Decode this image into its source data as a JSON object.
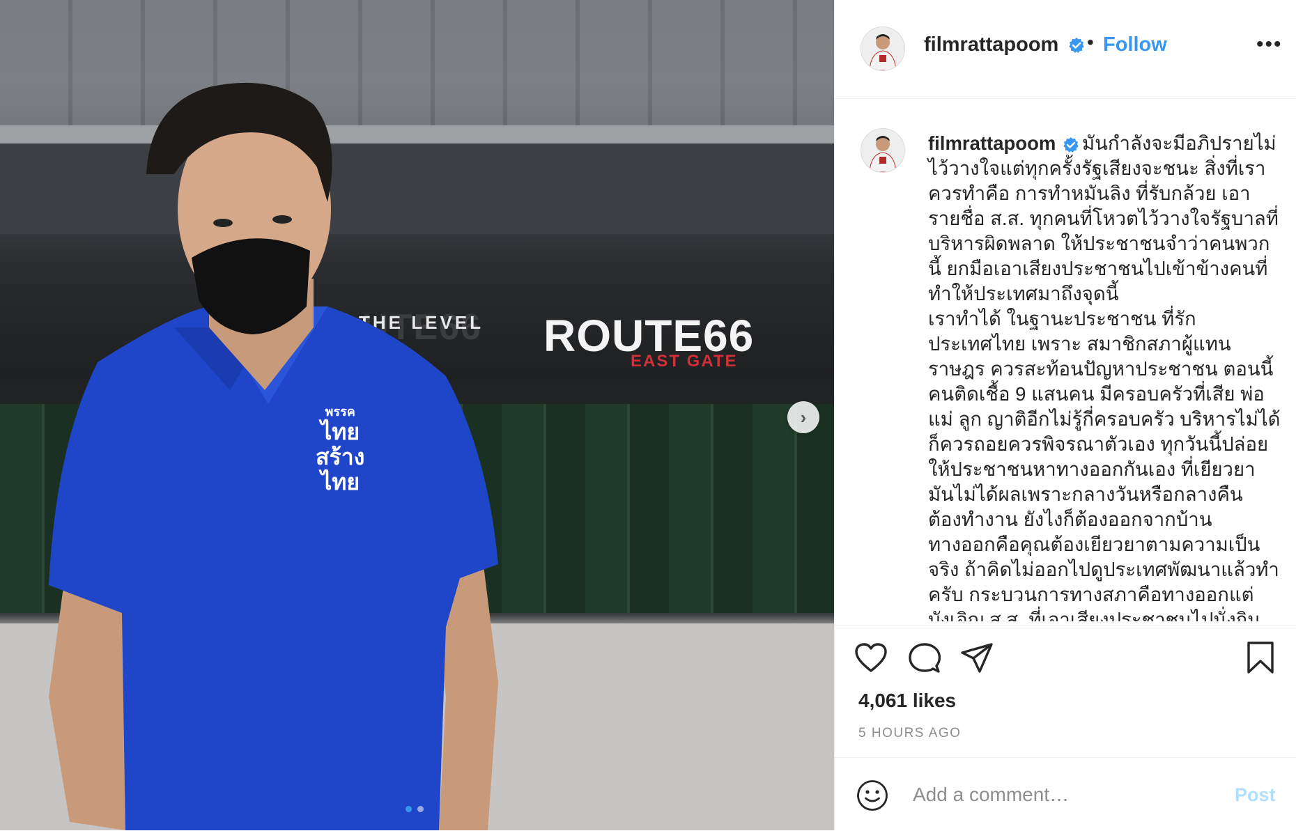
{
  "photo": {
    "signs": {
      "left_main": "UTE66",
      "left_sub": "THE LEVEL",
      "right_main": "ROUTE66",
      "right_sub": "EAST GATE"
    },
    "shirt_text": [
      "พรรค",
      "ไทย",
      "สร้าง",
      "ไทย"
    ],
    "carousel_dots": 2,
    "active_dot": 0
  },
  "header": {
    "username": "filmrattapoom",
    "separator": "•",
    "follow_label": "Follow",
    "more_label": "•••"
  },
  "caption": {
    "username": "filmrattapoom",
    "text": "มันกำลังจะมีอภิปรายไม่ไว้วางใจแต่ทุกครั้งรัฐเสียงจะชนะ สิ่งที่เราควรทำคือ การทำหมันลิง ที่รับกล้วย เอารายชื่อ ส.ส. ทุกคนที่โหวตไว้วางใจรัฐบาลที่บริหารผิดพลาด ให้ประชาชนจำว่าคนพวกนี้ ยกมือเอาเสียงประชาชนไปเข้าข้างคนที่ทำให้ประเทศมาถึงจุดนี้\nเราทำได้ ในฐานะประชาชน ที่รักประเทศไทย เพราะ สมาชิกสภาผู้แทนราษฎร ควรสะท้อนปัญหาประชาชน ตอนนี้คนติดเชื้อ 9 แสนคน มีครอบครัวที่เสีย พ่อ แม่ ลูก ญาติอีกไม่รู้กี่ครอบครัว บริหารไม่ได้ก็ควรถอยควรพิจรณาตัวเอง ทุกวันนี้ปล่อยให้ประชาชนหาทางออกกันเอง ที่เยียวยามันไม่ได้ผลเพราะกลางวันหรือกลางคืน ต้องทำงาน ยังไงก็ต้องออกจากบ้าน ทางออกคือคุณต้องเยียวยาตามความเป็นจริง ถ้าคิดไม่ออกไปดูประเทศพัฒนาแล้วทำครับ กระบวนการทางสภาคือทางออกแต่บังเอิญ ส.ส. ที่เอาเสียงประชาชนไปนั่งกินภาษีไม่เคยได้ยินเสียงคนติดเชื้อ หรือคนตายใน"
  },
  "stats": {
    "likes": "4,061 likes",
    "time": "5 HOURS AGO"
  },
  "comment": {
    "placeholder": "Add a comment…",
    "post_label": "Post"
  },
  "colors": {
    "accent": "#3897f0",
    "post_disabled": "#b2dffc",
    "verified": "#3897f0",
    "shirt": "#1f46c8"
  }
}
